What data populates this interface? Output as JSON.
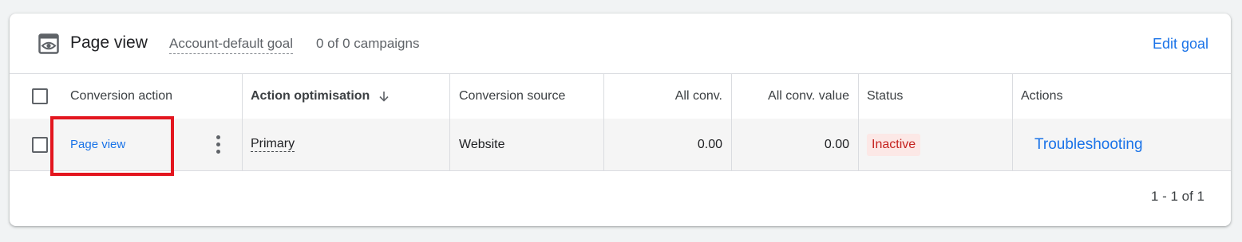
{
  "goal": {
    "icon": "eye-window-icon",
    "title": "Page view",
    "subtitle": "Account-default goal",
    "campaigns": "0 of 0 campaigns",
    "edit_label": "Edit goal"
  },
  "table": {
    "headers": {
      "conversion_action": "Conversion action",
      "action_optimisation": "Action optimisation",
      "sort_icon": "arrow-down-icon",
      "conversion_source": "Conversion source",
      "all_conv": "All conv.",
      "all_conv_value": "All conv. value",
      "status": "Status",
      "actions": "Actions"
    },
    "rows": [
      {
        "conversion_action": "Page view",
        "action_optimisation": "Primary",
        "conversion_source": "Website",
        "all_conv": "0.00",
        "all_conv_value": "0.00",
        "status": "Inactive",
        "actions": "Troubleshooting"
      }
    ],
    "pagination": "1 - 1 of 1"
  },
  "colors": {
    "accent": "#1a73e8",
    "inactive_text": "#c5221f",
    "inactive_bg": "#fce8e6",
    "highlight": "#e3161f"
  }
}
